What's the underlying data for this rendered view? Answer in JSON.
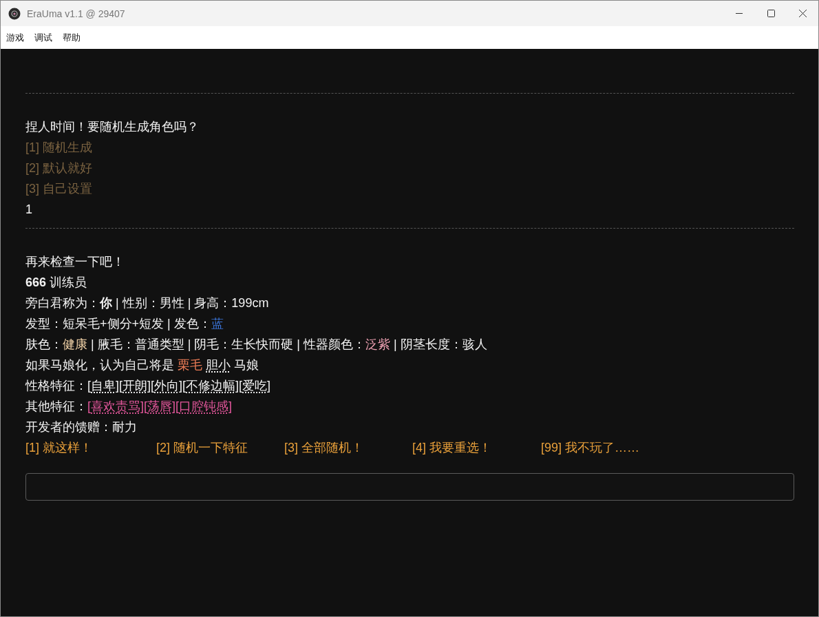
{
  "window": {
    "title": "EraUma v1.1 @ 29407"
  },
  "menu": [
    "游戏",
    "调试",
    "帮助"
  ],
  "blocks": [
    {
      "kind": "rule"
    },
    {
      "kind": "text",
      "segments": [
        {
          "text": "捏人时间！要随机生成角色吗？"
        }
      ]
    },
    {
      "kind": "option",
      "text": "[1] 随机生成",
      "disabled": true
    },
    {
      "kind": "option",
      "text": "[2] 默认就好",
      "disabled": true
    },
    {
      "kind": "option",
      "text": "[3] 自己设置",
      "disabled": true
    },
    {
      "kind": "text",
      "segments": [
        {
          "text": "1"
        }
      ]
    },
    {
      "kind": "rule"
    },
    {
      "kind": "text",
      "segments": [
        {
          "text": "再来检查一下吧！"
        }
      ]
    },
    {
      "kind": "text",
      "segments": [
        {
          "text": "**666** 训练员"
        }
      ]
    },
    {
      "kind": "text",
      "segments": [
        {
          "text": "旁白君称为：**你** | 性别：男性 | 身高：199cm"
        }
      ]
    },
    {
      "kind": "text",
      "segments": [
        {
          "text": "发型：短呆毛+侧分+短发 | 发色："
        },
        {
          "text": "蓝",
          "color": "#3b74d8"
        }
      ]
    },
    {
      "kind": "text",
      "segments": [
        {
          "text": "肤色："
        },
        {
          "text": "健康",
          "color": "#f2d3a8"
        },
        {
          "text": " | 腋毛：普通类型 | 阴毛：生长快而硬 | 性器颜色："
        },
        {
          "text": "泛紫",
          "color": "#f0a2b4"
        },
        {
          "text": " | 阴茎长度：骇人"
        }
      ]
    },
    {
      "kind": "text",
      "segments": [
        {
          "text": "如果马娘化，认为自己将是 "
        },
        {
          "text": "栗毛 ",
          "color": "#ec7c56"
        },
        {
          "text": "胆小",
          "dotted": true
        },
        {
          "text": " 马娘"
        }
      ]
    },
    {
      "kind": "text",
      "segments": [
        {
          "text": "性格特征：["
        },
        {
          "text": "自卑",
          "dotted": true
        },
        {
          "text": "]["
        },
        {
          "text": "开朗",
          "dotted": true
        },
        {
          "text": "]["
        },
        {
          "text": "外向",
          "dotted": true
        },
        {
          "text": "]["
        },
        {
          "text": "不修边幅",
          "dotted": true
        },
        {
          "text": "]["
        },
        {
          "text": "爱吃",
          "dotted": true
        },
        {
          "text": "]"
        }
      ]
    },
    {
      "kind": "text",
      "segments": [
        {
          "text": "其他特征："
        },
        {
          "text": "[",
          "color": "#e4579c"
        },
        {
          "text": "喜欢责骂",
          "color": "#e4579c",
          "dotted": true
        },
        {
          "text": "][",
          "color": "#e4579c"
        },
        {
          "text": "荡唇",
          "color": "#e4579c",
          "dotted": true
        },
        {
          "text": "][",
          "color": "#e4579c"
        },
        {
          "text": "口腔钝感",
          "color": "#e4579c",
          "dotted": true
        },
        {
          "text": "]",
          "color": "#e4579c"
        }
      ]
    },
    {
      "kind": "text",
      "segments": [
        {
          "text": "开发者的馈赠：耐力"
        }
      ]
    },
    {
      "kind": "choices",
      "items": [
        {
          "text": "[1] 就这样！",
          "disabled": false
        },
        {
          "text": "[2] 随机一下特征",
          "disabled": false
        },
        {
          "text": "[3] 全部随机！",
          "disabled": false
        },
        {
          "text": "[4] 我要重选！",
          "disabled": false
        },
        {
          "text": "[99] 我不玩了……",
          "disabled": false
        }
      ]
    }
  ]
}
